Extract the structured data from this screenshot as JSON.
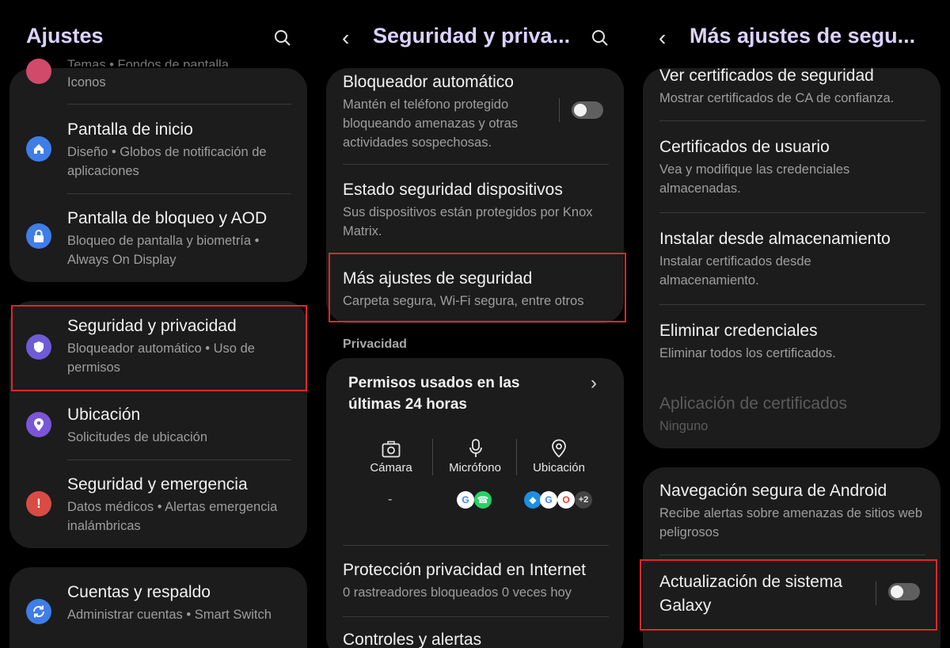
{
  "panel1": {
    "title": "Ajustes",
    "partial": {
      "top": "Temas  •  Fondos de pantalla",
      "subtitle": "Iconos"
    },
    "items": [
      {
        "title": "Pantalla de inicio",
        "subtitle": "Diseño  •  Globos de notificación de aplicaciones",
        "icon": "home-icon",
        "color": "#3f7de8"
      },
      {
        "title": "Pantalla de bloqueo y AOD",
        "subtitle": "Bloqueo de pantalla y biometría  •  Always On Display",
        "icon": "lock-icon",
        "color": "#3f7de8"
      },
      {
        "title": "Seguridad y privacidad",
        "subtitle": "Bloqueador automático  •  Uso de permisos",
        "icon": "shield-icon",
        "color": "#6f5bd6"
      },
      {
        "title": "Ubicación",
        "subtitle": "Solicitudes de ubicación",
        "icon": "location-pin-icon",
        "color": "#7a55d8"
      },
      {
        "title": "Seguridad y emergencia",
        "subtitle": "Datos médicos  •  Alertas emergencia inalámbricas",
        "icon": "alert-icon",
        "color": "#d94b44"
      },
      {
        "title": "Cuentas y respaldo",
        "subtitle": "Administrar cuentas  •  Smart Switch",
        "icon": "sync-icon",
        "color": "#3f7de8"
      }
    ]
  },
  "panel2": {
    "title": "Seguridad y priva...",
    "items": [
      {
        "title": "Bloqueador automático",
        "subtitle": "Mantén el teléfono protegido bloqueando amenazas y otras actividades sospechosas."
      },
      {
        "title": "Estado seguridad dispositivos",
        "subtitle": "Sus dispositivos están protegidos por Knox Matrix."
      },
      {
        "title": "Más ajustes de seguridad",
        "subtitle": "Carpeta segura, Wi-Fi segura, entre otros"
      }
    ],
    "section": "Privacidad",
    "permisos": {
      "title": "Permisos usados en las últimas 24 horas",
      "camera": "Cámara",
      "mic": "Micrófono",
      "location": "Ubicación",
      "camera_apps": "-",
      "more_count": "+2"
    },
    "items2": [
      {
        "title": "Protección privacidad en Internet",
        "subtitle": "0 rastreadores bloqueados 0 veces hoy"
      },
      {
        "title": "Controles y alertas"
      }
    ]
  },
  "panel3": {
    "title": "Más ajustes de segu...",
    "items": [
      {
        "title": "Ver certificados de seguridad",
        "subtitle": "Mostrar certificados de CA de confianza."
      },
      {
        "title": "Certificados de usuario",
        "subtitle": "Vea y modifique las credenciales almacenadas."
      },
      {
        "title": "Instalar desde almacenamiento",
        "subtitle": "Instalar certificados desde almacenamiento."
      },
      {
        "title": "Eliminar credenciales",
        "subtitle": "Eliminar todos los certificados."
      },
      {
        "title": "Aplicación de certificados",
        "subtitle": "Ninguno"
      }
    ],
    "items2": [
      {
        "title": "Navegación segura de Android",
        "subtitle": "Recibe alertas sobre amenazas de sitios web peligrosos"
      },
      {
        "title": "Actualización de sistema Galaxy"
      }
    ]
  },
  "colors": {
    "accent_title": "#dcd3ff",
    "highlight": "#e0262e",
    "card": "#1c1c1c"
  }
}
